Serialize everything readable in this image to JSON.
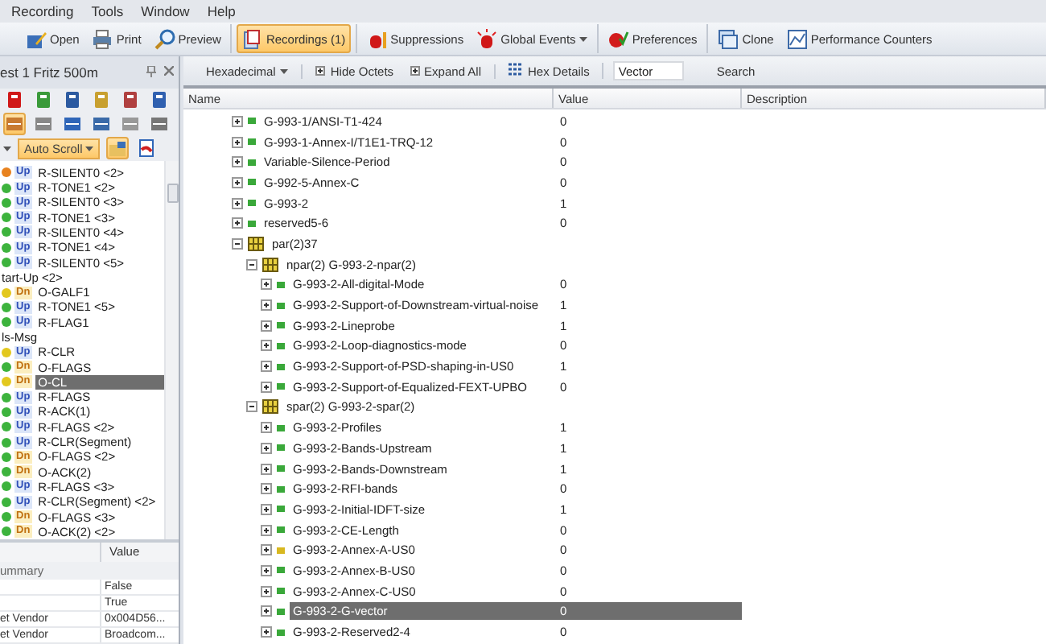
{
  "menu": [
    "Recording",
    "Tools",
    "Window",
    "Help"
  ],
  "toolbar": {
    "groups": [
      [
        {
          "label": "Open",
          "selected": false,
          "dropdown": false
        },
        {
          "label": "Print",
          "selected": false,
          "dropdown": false
        },
        {
          "label": "Preview",
          "selected": false,
          "dropdown": false
        }
      ],
      [
        {
          "label": "Recordings (1)",
          "selected": true,
          "dropdown": false
        }
      ],
      [
        {
          "label": "Suppressions",
          "selected": false,
          "dropdown": false
        },
        {
          "label": "Global Events",
          "selected": false,
          "dropdown": true
        }
      ],
      [
        {
          "label": "Preferences",
          "selected": false,
          "dropdown": false
        }
      ],
      [
        {
          "label": "Clone",
          "selected": false,
          "dropdown": false
        },
        {
          "label": "Performance Counters",
          "selected": false,
          "dropdown": false
        }
      ]
    ]
  },
  "left_panel": {
    "title": "est 1 Fritz 500m",
    "auto_scroll": {
      "label": "Auto Scroll",
      "on": true
    },
    "messages": [
      {
        "kind": "uplink",
        "badge": "Up",
        "name": "R-SILENT0 <2>",
        "color": "#e8821e",
        "selected": false
      },
      {
        "kind": "uplink",
        "badge": "Up",
        "name": "R-TONE1 <2>",
        "color": "#3db33d",
        "selected": false
      },
      {
        "kind": "uplink",
        "badge": "Up",
        "name": "R-SILENT0 <3>",
        "color": "#3db33d",
        "selected": false
      },
      {
        "kind": "uplink",
        "badge": "Up",
        "name": "R-TONE1 <3>",
        "color": "#3db33d",
        "selected": false
      },
      {
        "kind": "uplink",
        "badge": "Up",
        "name": "R-SILENT0 <4>",
        "color": "#3db33d",
        "selected": false
      },
      {
        "kind": "uplink",
        "badge": "Up",
        "name": "R-TONE1 <4>",
        "color": "#3db33d",
        "selected": false
      },
      {
        "kind": "uplink",
        "badge": "Up",
        "name": "R-SILENT0 <5>",
        "color": "#3db33d",
        "selected": false
      },
      {
        "kind": "group",
        "name": "tart-Up <2>"
      },
      {
        "kind": "downlink",
        "badge": "Dn",
        "name": "O-GALF1",
        "color": "#e3c81e",
        "selected": false
      },
      {
        "kind": "uplink",
        "badge": "Up",
        "name": "R-TONE1 <5>",
        "color": "#3db33d",
        "selected": false
      },
      {
        "kind": "uplink",
        "badge": "Up",
        "name": "R-FLAG1",
        "color": "#3db33d",
        "selected": false
      },
      {
        "kind": "group",
        "name": "ls-Msg"
      },
      {
        "kind": "uplink",
        "badge": "Up",
        "name": "R-CLR",
        "color": "#e3c81e",
        "selected": false
      },
      {
        "kind": "downlink",
        "badge": "Dn",
        "name": "O-FLAGS",
        "color": "#3db33d",
        "selected": false
      },
      {
        "kind": "downlink",
        "badge": "Dn",
        "name": "O-CL",
        "color": "#e3c81e",
        "selected": true
      },
      {
        "kind": "uplink",
        "badge": "Up",
        "name": "R-FLAGS",
        "color": "#3db33d",
        "selected": false
      },
      {
        "kind": "uplink",
        "badge": "Up",
        "name": "R-ACK(1)",
        "color": "#3db33d",
        "selected": false
      },
      {
        "kind": "uplink",
        "badge": "Up",
        "name": "R-FLAGS <2>",
        "color": "#3db33d",
        "selected": false
      },
      {
        "kind": "uplink",
        "badge": "Up",
        "name": "R-CLR(Segment)",
        "color": "#3db33d",
        "selected": false
      },
      {
        "kind": "downlink",
        "badge": "Dn",
        "name": "O-FLAGS <2>",
        "color": "#3db33d",
        "selected": false
      },
      {
        "kind": "downlink",
        "badge": "Dn",
        "name": "O-ACK(2)",
        "color": "#3db33d",
        "selected": false
      },
      {
        "kind": "uplink",
        "badge": "Up",
        "name": "R-FLAGS <3>",
        "color": "#3db33d",
        "selected": false
      },
      {
        "kind": "uplink",
        "badge": "Up",
        "name": "R-CLR(Segment) <2>",
        "color": "#3db33d",
        "selected": false
      },
      {
        "kind": "downlink",
        "badge": "Dn",
        "name": "O-FLAGS <3>",
        "color": "#3db33d",
        "selected": false
      },
      {
        "kind": "downlink",
        "badge": "Dn",
        "name": "O-ACK(2) <2>",
        "color": "#3db33d",
        "selected": false
      }
    ],
    "properties": {
      "columns": [
        "Value"
      ],
      "group": "ummary",
      "rows": [
        {
          "value": "False"
        },
        {
          "value": "True"
        },
        {
          "name": "et Vendor",
          "value": "0x004D56..."
        },
        {
          "name": "et Vendor",
          "value": "Broadcom..."
        }
      ]
    }
  },
  "hex_toolbar": {
    "format": "Hexadecimal",
    "hide_octets": "Hide Octets",
    "expand_all": "Expand All",
    "hex_details": "Hex Details",
    "search_value": "Vector",
    "search": "Search"
  },
  "tree": {
    "columns": [
      "Name",
      "Value",
      "Description"
    ],
    "nodes": [
      {
        "kind": "leaf",
        "label": "G-993-1/ANSI-T1-424",
        "value": "0",
        "color": "#3aa83a",
        "selected": false
      },
      {
        "kind": "leaf",
        "label": "G-993-1-Annex-I/T1E1-TRQ-12",
        "value": "0",
        "color": "#3aa83a",
        "selected": false
      },
      {
        "kind": "leaf",
        "label": "Variable-Silence-Period",
        "value": "0",
        "color": "#3aa83a",
        "selected": false
      },
      {
        "kind": "leaf",
        "label": "G-992-5-Annex-C",
        "value": "0",
        "color": "#3aa83a",
        "selected": false
      },
      {
        "kind": "leaf",
        "label": "G-993-2",
        "value": "1",
        "color": "#3aa83a",
        "selected": false
      },
      {
        "kind": "leaf",
        "label": "reserved5-6",
        "value": "0",
        "color": "#3aa83a",
        "selected": false
      },
      {
        "kind": "group",
        "label": "par(2)37",
        "expanded": true,
        "selected": false,
        "children": [
          {
            "kind": "group",
            "label": "npar(2) G-993-2-npar(2)",
            "expanded": true,
            "selected": false,
            "children": [
              {
                "kind": "leaf",
                "label": "G-993-2-All-digital-Mode",
                "value": "0",
                "color": "#3aa83a",
                "selected": false
              },
              {
                "kind": "leaf",
                "label": "G-993-2-Support-of-Downstream-virtual-noise",
                "value": "1",
                "color": "#3aa83a",
                "selected": false
              },
              {
                "kind": "leaf",
                "label": "G-993-2-Lineprobe",
                "value": "1",
                "color": "#3aa83a",
                "selected": false
              },
              {
                "kind": "leaf",
                "label": "G-993-2-Loop-diagnostics-mode",
                "value": "0",
                "color": "#3aa83a",
                "selected": false
              },
              {
                "kind": "leaf",
                "label": "G-993-2-Support-of-PSD-shaping-in-US0",
                "value": "1",
                "color": "#3aa83a",
                "selected": false
              },
              {
                "kind": "leaf",
                "label": "G-993-2-Support-of-Equalized-FEXT-UPBO",
                "value": "0",
                "color": "#3aa83a",
                "selected": false
              }
            ]
          },
          {
            "kind": "group",
            "label": "spar(2) G-993-2-spar(2)",
            "expanded": true,
            "selected": false,
            "children": [
              {
                "kind": "leaf",
                "label": "G-993-2-Profiles",
                "value": "1",
                "color": "#3aa83a",
                "selected": false
              },
              {
                "kind": "leaf",
                "label": "G-993-2-Bands-Upstream",
                "value": "1",
                "color": "#3aa83a",
                "selected": false
              },
              {
                "kind": "leaf",
                "label": "G-993-2-Bands-Downstream",
                "value": "1",
                "color": "#3aa83a",
                "selected": false
              },
              {
                "kind": "leaf",
                "label": "G-993-2-RFI-bands",
                "value": "0",
                "color": "#3aa83a",
                "selected": false
              },
              {
                "kind": "leaf",
                "label": "G-993-2-Initial-IDFT-size",
                "value": "1",
                "color": "#3aa83a",
                "selected": false
              },
              {
                "kind": "leaf",
                "label": "G-993-2-CE-Length",
                "value": "0",
                "color": "#3aa83a",
                "selected": false
              },
              {
                "kind": "leaf",
                "label": "G-993-2-Annex-A-US0",
                "value": "0",
                "color": "#d8b820",
                "selected": false
              },
              {
                "kind": "leaf",
                "label": "G-993-2-Annex-B-US0",
                "value": "0",
                "color": "#3aa83a",
                "selected": false
              },
              {
                "kind": "leaf",
                "label": "G-993-2-Annex-C-US0",
                "value": "0",
                "color": "#3aa83a",
                "selected": false
              },
              {
                "kind": "leaf",
                "label": "G-993-2-G-vector",
                "value": "0",
                "color": "#3aa83a",
                "selected": true
              },
              {
                "kind": "leaf",
                "label": "G-993-2-Reserved2-4",
                "value": "0",
                "color": "#3aa83a",
                "selected": false
              }
            ]
          }
        ]
      }
    ]
  }
}
